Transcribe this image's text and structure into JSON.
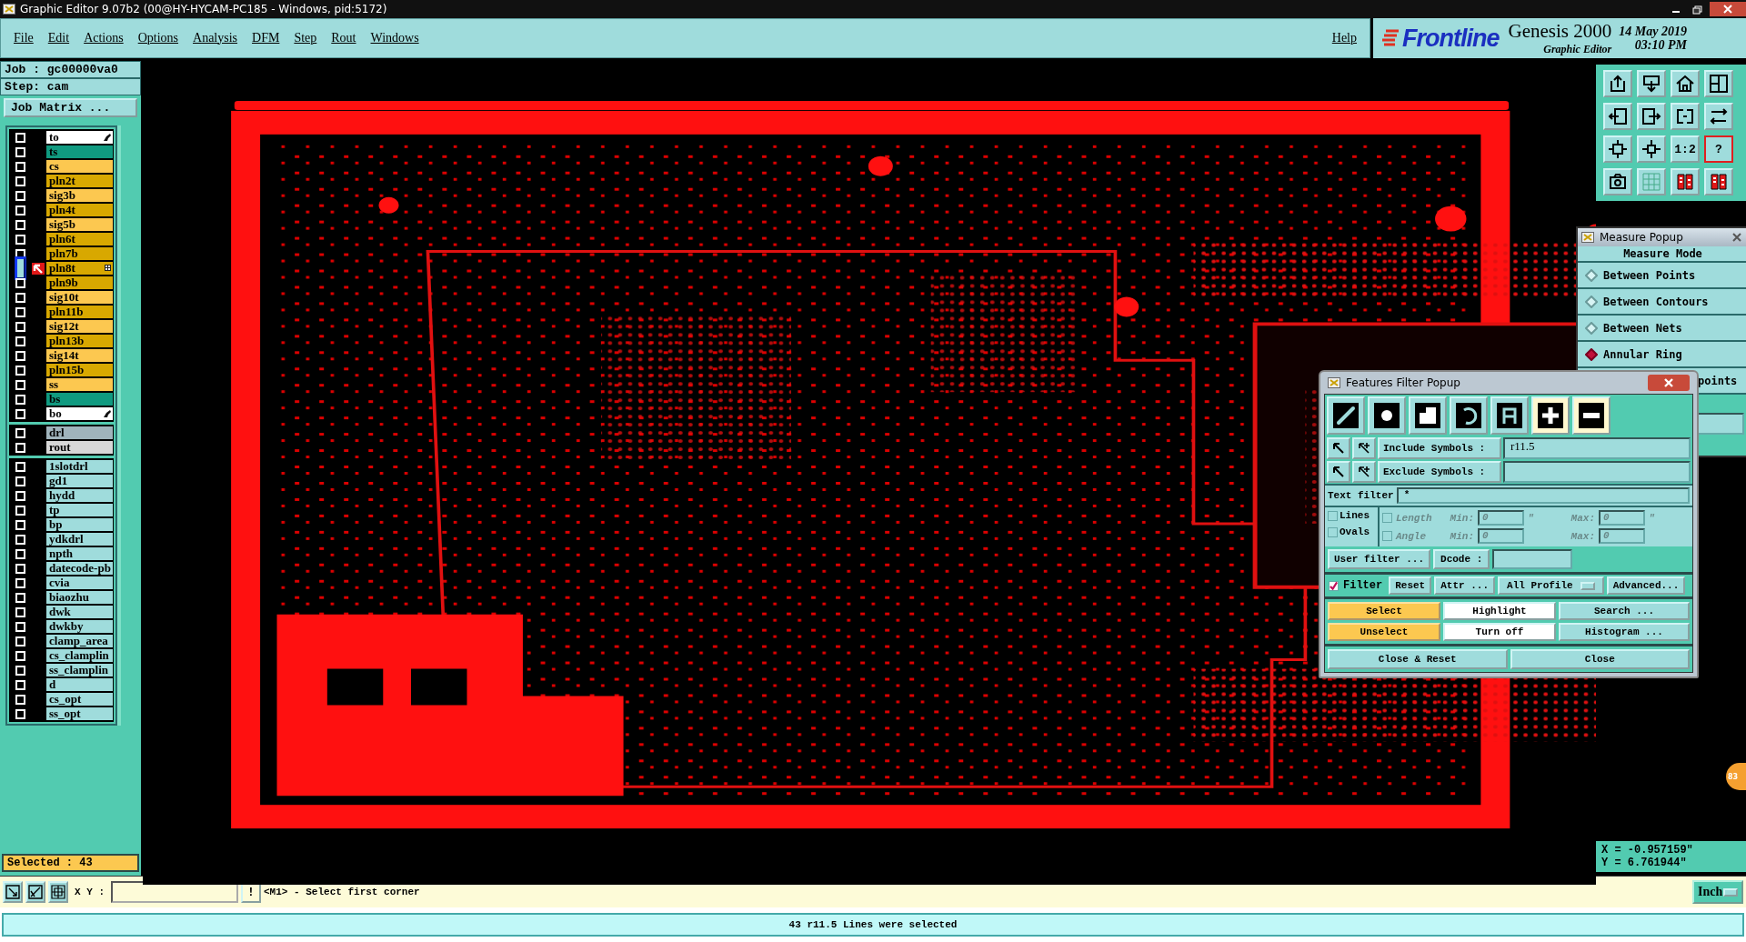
{
  "window": {
    "title": "Graphic Editor 9.07b2 (00@HY-HYCAM-PC185 - Windows, pid:5172)"
  },
  "menu": [
    "File",
    "Edit",
    "Actions",
    "Options",
    "Analysis",
    "DFM",
    "Step",
    "Rout",
    "Windows"
  ],
  "help": "Help",
  "brand": {
    "logo": "Frontline",
    "product": "Genesis 2000",
    "subtitle": "Graphic Editor",
    "date": "14 May 2019",
    "time": "03:10 PM"
  },
  "job": {
    "job_label": "Job : gc00000va0",
    "step_label": "Step: cam",
    "matrix_button": "Job Matrix ..."
  },
  "layer_groups": [
    [
      {
        "name": "to",
        "color": "#ffffff",
        "pinned": true,
        "active": false
      },
      {
        "name": "ts",
        "color": "#109a80",
        "pinned": false,
        "active": false
      },
      {
        "name": "cs",
        "color": "#fcc850",
        "pinned": false,
        "active": false
      },
      {
        "name": "pln2t",
        "color": "#d8a800",
        "pinned": false,
        "active": false
      },
      {
        "name": "sig3b",
        "color": "#fcc850",
        "pinned": false,
        "active": false
      },
      {
        "name": "pln4t",
        "color": "#d8a800",
        "pinned": false,
        "active": false
      },
      {
        "name": "sig5b",
        "color": "#fcc850",
        "pinned": false,
        "active": false
      },
      {
        "name": "pln6t",
        "color": "#d8a800",
        "pinned": false,
        "active": false
      },
      {
        "name": "pln7b",
        "color": "#d8a800",
        "pinned": false,
        "active": false
      },
      {
        "name": "pln8t",
        "color": "#d8a800",
        "pinned": false,
        "active": true
      },
      {
        "name": "pln9b",
        "color": "#d8a800",
        "pinned": false,
        "active": false
      },
      {
        "name": "sig10t",
        "color": "#fcc850",
        "pinned": false,
        "active": false
      },
      {
        "name": "pln11b",
        "color": "#d8a800",
        "pinned": false,
        "active": false
      },
      {
        "name": "sig12t",
        "color": "#fcc850",
        "pinned": false,
        "active": false
      },
      {
        "name": "pln13b",
        "color": "#d8a800",
        "pinned": false,
        "active": false
      },
      {
        "name": "sig14t",
        "color": "#fcc850",
        "pinned": false,
        "active": false
      },
      {
        "name": "pln15b",
        "color": "#d8a800",
        "pinned": false,
        "active": false
      },
      {
        "name": "ss",
        "color": "#fcc850",
        "pinned": false,
        "active": false
      },
      {
        "name": "bs",
        "color": "#109a80",
        "pinned": false,
        "active": false
      },
      {
        "name": "bo",
        "color": "#ffffff",
        "pinned": true,
        "active": false
      }
    ],
    [
      {
        "name": "drl",
        "color": "#a0b4bc",
        "pinned": false,
        "active": false
      },
      {
        "name": "rout",
        "color": "#d8d8d8",
        "pinned": false,
        "active": false
      }
    ],
    [
      {
        "name": "1slotdrl",
        "color": "#9fdcdc",
        "pinned": false,
        "active": false
      },
      {
        "name": "gd1",
        "color": "#9fdcdc",
        "pinned": false,
        "active": false
      },
      {
        "name": "hydd",
        "color": "#9fdcdc",
        "pinned": false,
        "active": false
      },
      {
        "name": "tp",
        "color": "#9fdcdc",
        "pinned": false,
        "active": false
      },
      {
        "name": "bp",
        "color": "#9fdcdc",
        "pinned": false,
        "active": false
      },
      {
        "name": "ydkdrl",
        "color": "#9fdcdc",
        "pinned": false,
        "active": false
      },
      {
        "name": "npth",
        "color": "#9fdcdc",
        "pinned": false,
        "active": false
      },
      {
        "name": "datecode-pb",
        "color": "#9fdcdc",
        "pinned": false,
        "active": false
      },
      {
        "name": "cvia",
        "color": "#9fdcdc",
        "pinned": false,
        "active": false
      },
      {
        "name": "biaozhu",
        "color": "#9fdcdc",
        "pinned": false,
        "active": false
      },
      {
        "name": "dwk",
        "color": "#9fdcdc",
        "pinned": false,
        "active": false
      },
      {
        "name": "dwkby",
        "color": "#9fdcdc",
        "pinned": false,
        "active": false
      },
      {
        "name": "clamp_area",
        "color": "#9fdcdc",
        "pinned": false,
        "active": false
      },
      {
        "name": "cs_clamplin",
        "color": "#9fdcdc",
        "pinned": false,
        "active": false
      },
      {
        "name": "ss_clamplin",
        "color": "#9fdcdc",
        "pinned": false,
        "active": false
      },
      {
        "name": "d",
        "color": "#9fdcdc",
        "pinned": false,
        "active": false
      },
      {
        "name": "cs_opt",
        "color": "#9fdcdc",
        "pinned": false,
        "active": false
      },
      {
        "name": "ss_opt",
        "color": "#9fdcdc",
        "pinned": false,
        "active": false
      }
    ]
  ],
  "selected_count": "Selected : 43",
  "toolbar": [
    {
      "kind": "tray-up"
    },
    {
      "kind": "tray-down"
    },
    {
      "kind": "home"
    },
    {
      "kind": "panes"
    },
    {
      "kind": "box-left"
    },
    {
      "kind": "box-right"
    },
    {
      "kind": "split"
    },
    {
      "kind": "swap"
    },
    {
      "kind": "fit"
    },
    {
      "kind": "move"
    },
    {
      "kind": "ratio",
      "label": "1:2"
    },
    {
      "kind": "help",
      "label": "?"
    },
    {
      "kind": "layers"
    },
    {
      "kind": "grid"
    },
    {
      "kind": "layer-stack"
    },
    {
      "kind": "layer-stack"
    }
  ],
  "measure_popup": {
    "title": "Measure Popup",
    "heading": "Measure Mode",
    "modes": [
      {
        "label": "Between Points",
        "selected": false,
        "covered": false
      },
      {
        "label": "Between Contours",
        "selected": false,
        "covered": false
      },
      {
        "label": "Between Nets",
        "selected": false,
        "covered": false
      },
      {
        "label": "Annular Ring",
        "selected": true,
        "covered": false
      },
      {
        "label": "points",
        "covered": true
      }
    ]
  },
  "filter_popup": {
    "title": "Features Filter Popup",
    "feature_types": [
      {
        "kind": "line",
        "selected": false
      },
      {
        "kind": "pad",
        "selected": false
      },
      {
        "kind": "surface",
        "selected": false
      },
      {
        "kind": "arc",
        "selected": false
      },
      {
        "kind": "text",
        "selected": false
      },
      {
        "kind": "positive",
        "selected": true
      },
      {
        "kind": "negative",
        "selected": true
      }
    ],
    "include": {
      "label": "Include Symbols :",
      "value": "r11.5"
    },
    "exclude": {
      "label": "Exclude Symbols :"
    },
    "text_filter": {
      "label": "Text filter",
      "value": "*"
    },
    "shape_checks": [
      {
        "label": "Lines",
        "checked": false
      },
      {
        "label": "Ovals",
        "checked": false
      }
    ],
    "ranges": [
      {
        "label": "Length",
        "checked": false,
        "disabled": true,
        "min_label": "Min:",
        "min": "0",
        "min_unit": "\"",
        "max_label": "Max:",
        "max": "0",
        "max_unit": "\""
      },
      {
        "label": "Angle",
        "checked": false,
        "disabled": true,
        "min_label": "Min:",
        "min": "0",
        "max_label": "Max:",
        "max": "0"
      }
    ],
    "user_filter": "User filter ...",
    "dcode_label": "Dcode :",
    "filter_toggle": {
      "label": "Filter",
      "checked": true
    },
    "reset": "Reset",
    "attr": "Attr ...",
    "profile": "All Profile",
    "advanced": "Advanced...",
    "actions": [
      {
        "label": "Select",
        "kind": "select"
      },
      {
        "label": "Highlight",
        "kind": "display"
      },
      {
        "label": "Search ...",
        "kind": "dialog"
      },
      {
        "label": "Unselect",
        "kind": "select"
      },
      {
        "label": "Turn off",
        "kind": "display"
      },
      {
        "label": "Histogram ...",
        "kind": "dialog"
      }
    ],
    "close_reset": "Close & Reset",
    "close": "Close"
  },
  "coordinates": {
    "x": "X = -0.957159\"",
    "y": "Y = 6.761944\""
  },
  "bottom_bar": {
    "tools": [
      {
        "kind": "zoom-box"
      },
      {
        "kind": "zoom-line"
      },
      {
        "kind": "grid"
      }
    ],
    "xy_label": "X Y :",
    "prompt_button": "!",
    "message": "<M1> - Select first corner",
    "units": "Inch"
  },
  "status": "43 r11.5 Lines were selected",
  "badge": "83"
}
